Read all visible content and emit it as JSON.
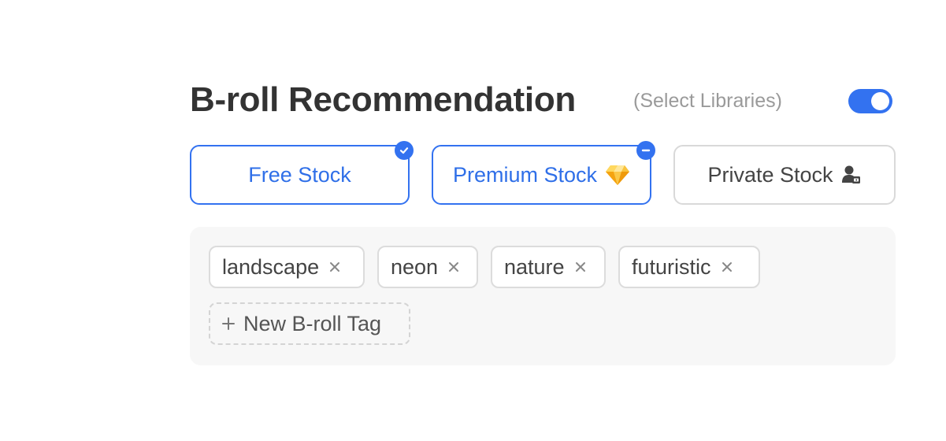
{
  "header": {
    "title": "B-roll Recommendation",
    "subtitle": "(Select Libraries)",
    "toggle_on": true
  },
  "sources": [
    {
      "label": "Free Stock",
      "state": "selected",
      "badge_icon": "check-icon"
    },
    {
      "label": "Premium Stock",
      "state": "selected",
      "trail_icon": "diamond-icon",
      "badge_icon": "minus-icon"
    },
    {
      "label": "Private Stock",
      "state": "unselected",
      "trail_icon": "private-user-icon"
    }
  ],
  "tags": [
    {
      "label": "landscape"
    },
    {
      "label": "neon"
    },
    {
      "label": "nature"
    },
    {
      "label": "futuristic"
    }
  ],
  "new_tag": {
    "label": "New B-roll Tag"
  },
  "colors": {
    "accent": "#3372f0",
    "title": "#333333",
    "subtitle": "#9a9a9a",
    "tags_background": "#f7f7f7"
  }
}
